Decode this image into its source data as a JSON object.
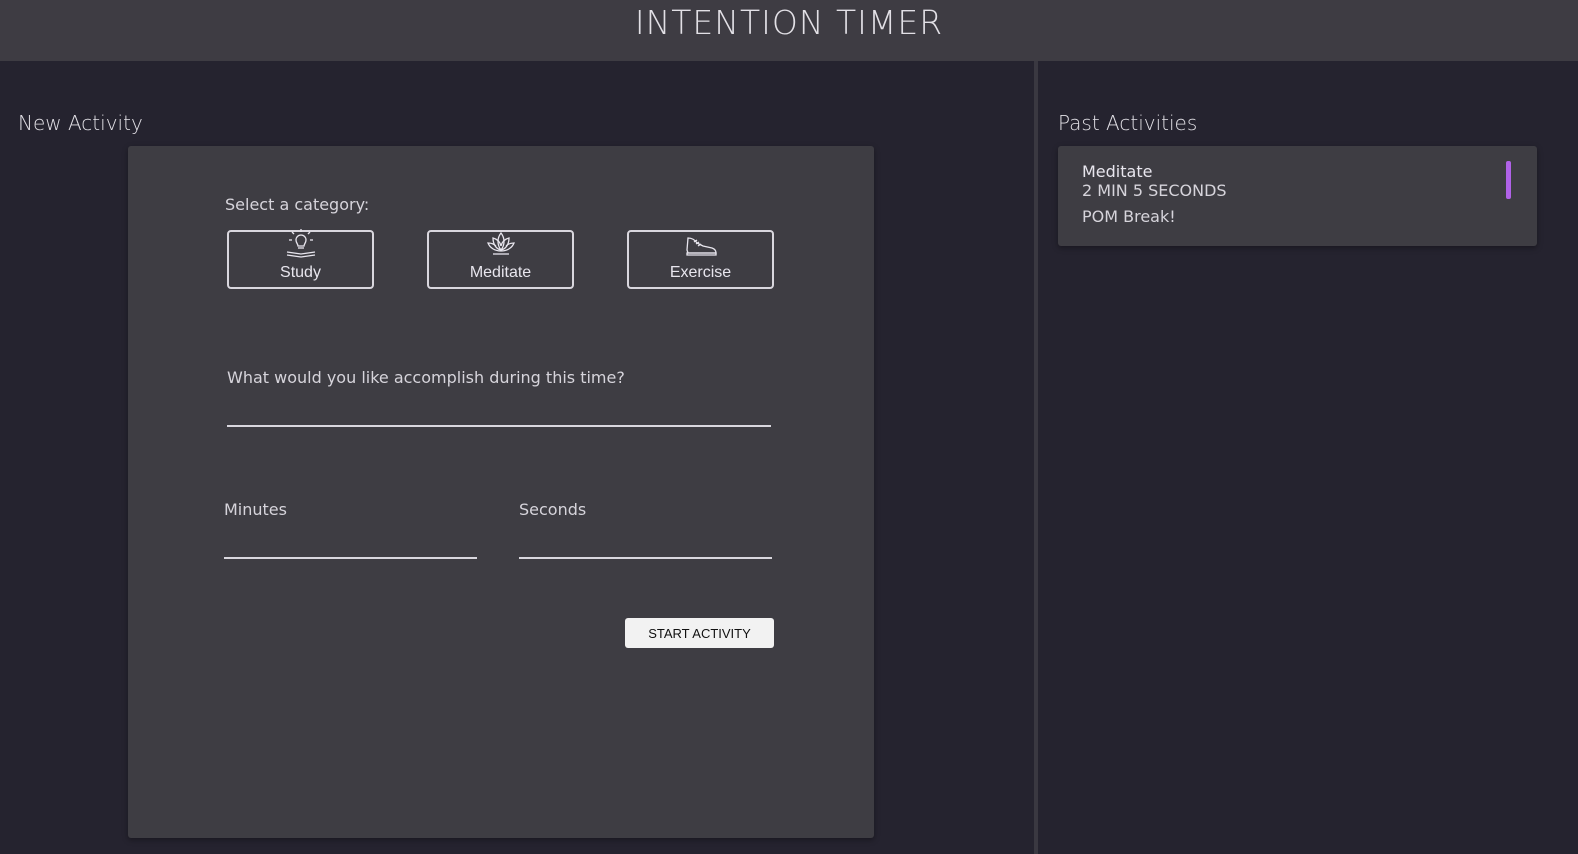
{
  "header": {
    "title": "INTENTION TIMER"
  },
  "new_activity": {
    "title": "New Activity",
    "category_prompt": "Select a category:",
    "categories": [
      {
        "label": "Study",
        "icon": "lightbulb-book-icon"
      },
      {
        "label": "Meditate",
        "icon": "lotus-icon"
      },
      {
        "label": "Exercise",
        "icon": "sneaker-icon"
      }
    ],
    "description_label": "What would you like accomplish during this time?",
    "description_value": "",
    "minutes_label": "Minutes",
    "minutes_value": "",
    "seconds_label": "Seconds",
    "seconds_value": "",
    "start_label": "START ACTIVITY"
  },
  "past_activities": {
    "title": "Past Activities",
    "items": [
      {
        "category": "Meditate",
        "duration": "2 MIN 5 SECONDS",
        "description": "POM Break!",
        "accent_color": "#b062e8"
      }
    ]
  },
  "colors": {
    "background": "#25232f",
    "header": "#3e3c43",
    "card": "#3e3d43",
    "meditate_accent": "#b062e8"
  }
}
